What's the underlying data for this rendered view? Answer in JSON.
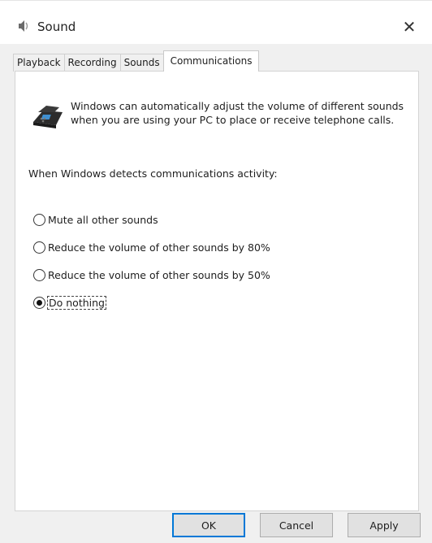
{
  "window": {
    "title": "Sound",
    "close_glyph": "✕"
  },
  "tabs": [
    {
      "label": "Playback",
      "active": false
    },
    {
      "label": "Recording",
      "active": false
    },
    {
      "label": "Sounds",
      "active": false
    },
    {
      "label": "Communications",
      "active": true
    }
  ],
  "panel": {
    "icon": "telephone-icon",
    "description": "Windows can automatically adjust the volume of different sounds when you are using your PC to place or receive telephone calls.",
    "detect_label": "When Windows detects communications activity:",
    "options": [
      {
        "label": "Mute all other sounds",
        "checked": false
      },
      {
        "label": "Reduce the volume of other sounds by 80%",
        "checked": false
      },
      {
        "label": "Reduce the volume of other sounds by 50%",
        "checked": false
      },
      {
        "label": "Do nothing",
        "checked": true
      }
    ]
  },
  "buttons": {
    "ok": "OK",
    "cancel": "Cancel",
    "apply": "Apply"
  },
  "colors": {
    "accent": "#0078d7",
    "dialog_bg": "#f0f0f0",
    "panel_bg": "#ffffff"
  }
}
